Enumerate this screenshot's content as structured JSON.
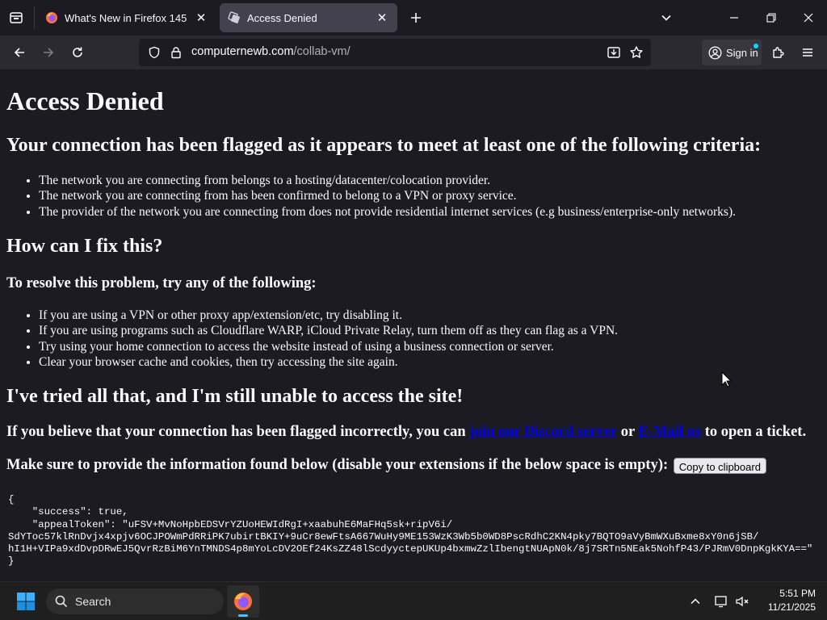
{
  "browser": {
    "tabs": [
      {
        "title": "What's New in Firefox 145",
        "favicon": "firefox-icon",
        "active": false
      },
      {
        "title": "Access Denied",
        "favicon": "vm-icon",
        "active": true
      }
    ],
    "url": {
      "domain": "computernewb.com",
      "path": "/collab-vm/"
    },
    "signin_label": "Sign in"
  },
  "page": {
    "title": "Access Denied",
    "flag_heading": "Your connection has been flagged as it appears to meet at least one of the following criteria:",
    "criteria": [
      "The network you are connecting from belongs to a hosting/datacenter/colocation provider.",
      "The network you are connecting from has been confirmed to belong to a VPN or proxy service.",
      "The provider of the network you are connecting from does not provide residential internet services (e.g business/enterprise-only networks)."
    ],
    "fix_heading": "How can I fix this?",
    "resolve_heading": "To resolve this problem, try any of the following:",
    "fixes": [
      "If you are using a VPN or other proxy app/extension/etc, try disabling it.",
      "If you are using programs such as Cloudflare WARP, iCloud Private Relay, turn them off as they can flag as a VPN.",
      "Try using your home connection to access the website instead of using a business connection or server.",
      "Clear your browser cache and cookies, then try accessing the site again."
    ],
    "tried_heading": "I've tried all that, and I'm still unable to access the site!",
    "ticket": {
      "prefix": "If you believe that your connection has been flagged incorrectly, you can ",
      "discord_link": "join our Discord server",
      "or": " or ",
      "email_link": "E-Mail us",
      "suffix": " to open a ticket."
    },
    "info_text": "Make sure to provide the information found below (disable your extensions if the below space is empty): ",
    "copy_button": "Copy to clipboard",
    "json_text": "{\n    \"success\": true,\n    \"appealToken\": \"uFSV+MvNoHpbEDSVrYZUoHEWIdRgI+xaabuhE6MaFHq5sk+ripV6i/\nSdYToc57klRnDvjx4xpjv6OCJPOWmPdRRiPK7ubirtBKIY+9uCr8ewFtsA667WuHy9ME153WzK3Wb5b0WD8PscRdhC2KN4pky7BQTO9aVyBmWXuBxme8xY0n6jSB/\nhI1H+VIPa9xdDvpDRwEJ5QvrRzBiM6YnTMNDS4p8mYoLcDV2OEf24KsZZ48lScdyyctepUKUp4bxmwZzlIbengtNUApN0k/8j7SRTn5NEak5NohfP43/PJRmV0DnpKgkKYA==\"\n}"
  },
  "taskbar": {
    "search_placeholder": "Search",
    "time": "5:51 PM",
    "date": "11/21/2025"
  },
  "colors": {
    "page_bg": "#1c1b22",
    "toolbar_bg": "#2b2a33",
    "link": "#0000ee",
    "text": "#fbfbfe"
  }
}
